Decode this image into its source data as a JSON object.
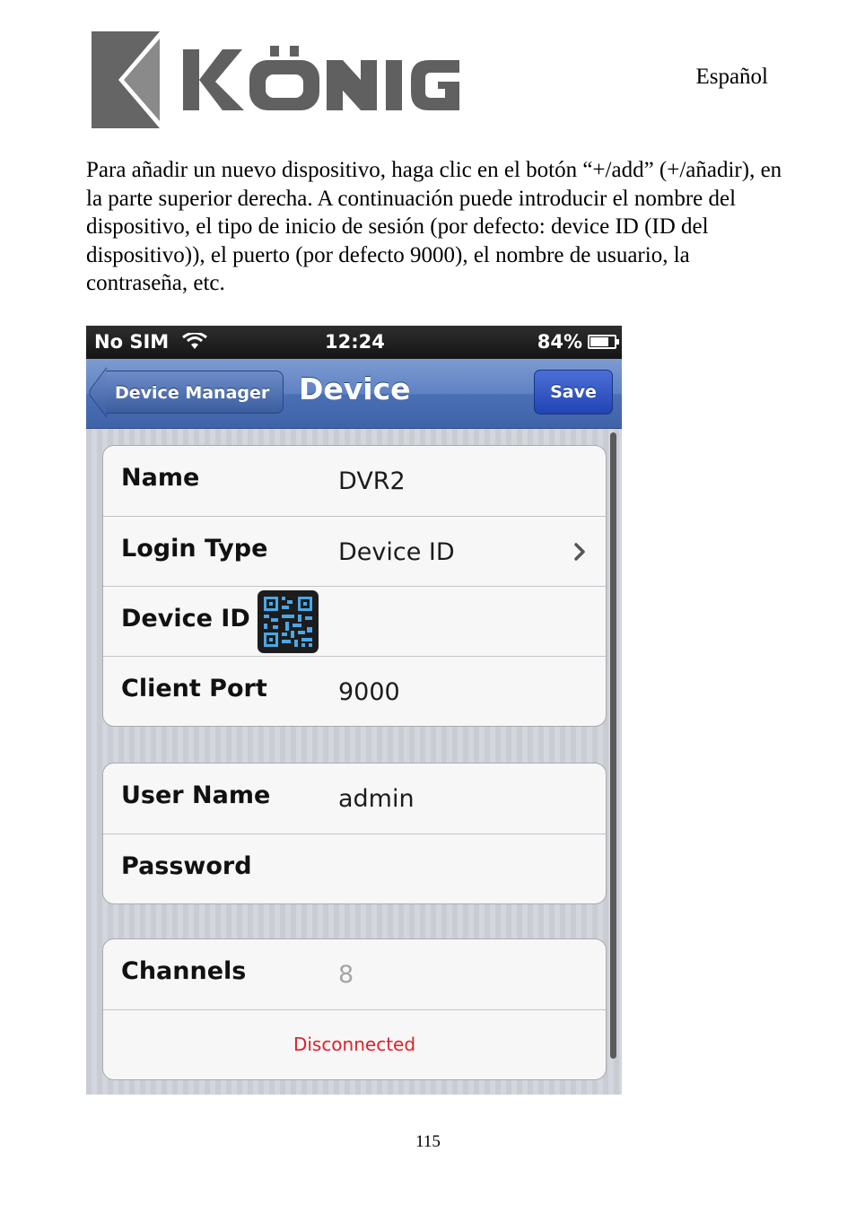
{
  "header": {
    "brand": "KÖNIG",
    "language": "Español"
  },
  "body": {
    "paragraph": "Para añadir un nuevo dispositivo, haga clic en el botón “+/add” (+/añadir), en la parte superior derecha. A continuación puede introducir el nombre del dispositivo, el tipo de inicio de sesión (por defecto: device ID (ID del dispositivo)), el puerto (por defecto 9000), el nombre de usuario, la contraseña, etc."
  },
  "phone": {
    "status_bar": {
      "carrier": "No SIM",
      "time": "12:24",
      "battery": "84%",
      "battery_level": 0.84
    },
    "nav": {
      "back_label": "Device Manager",
      "title": "Device",
      "save_label": "Save"
    },
    "groups": [
      {
        "rows": [
          {
            "label": "Name",
            "value": "DVR2"
          },
          {
            "label": "Login Type",
            "value": "Device ID"
          },
          {
            "label": "Device ID",
            "value": ""
          },
          {
            "label": "Client Port",
            "value": "9000"
          }
        ]
      },
      {
        "rows": [
          {
            "label": "User Name",
            "value": "admin"
          },
          {
            "label": "Password",
            "value": ""
          }
        ]
      },
      {
        "rows": [
          {
            "label": "Channels",
            "value": "8"
          }
        ],
        "status": "Disconnected"
      }
    ],
    "colors": {
      "nav_blue": "#4a6fb5",
      "save_blue": "#2144b5",
      "status_red": "#e0202a"
    }
  },
  "footer": {
    "page_number": "115"
  }
}
